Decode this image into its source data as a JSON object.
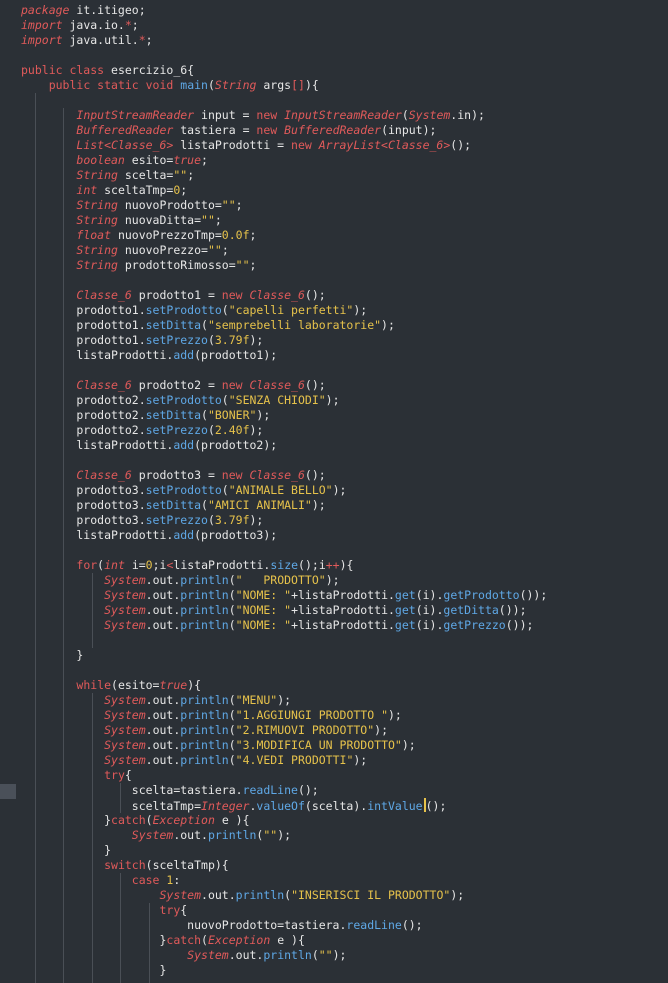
{
  "editor": {
    "language": "java",
    "cursor_line": 53,
    "lines": [
      [
        [
          "kwi",
          "package"
        ],
        [
          "in",
          " it.itigeo;"
        ]
      ],
      [
        [
          "kwi",
          "import"
        ],
        [
          "in",
          " java.io."
        ],
        [
          "kw",
          "*"
        ],
        [
          "in",
          ";"
        ]
      ],
      [
        [
          "kwi",
          "import"
        ],
        [
          "in",
          " java.util."
        ],
        [
          "kw",
          "*"
        ],
        [
          "in",
          ";"
        ]
      ],
      [],
      [
        [
          "kw",
          "public class "
        ],
        [
          "in",
          "esercizio_6{"
        ]
      ],
      [
        [
          "in",
          "    "
        ],
        [
          "kw",
          "public static void "
        ],
        [
          "fn",
          "main"
        ],
        [
          "in",
          "("
        ],
        [
          "ty",
          "String"
        ],
        [
          "in",
          " args"
        ],
        [
          "kw",
          "[]"
        ],
        [
          "in",
          "){"
        ]
      ],
      [],
      [
        [
          "in",
          "        "
        ],
        [
          "ty",
          "InputStreamReader"
        ],
        [
          "in",
          " input = "
        ],
        [
          "kw",
          "new "
        ],
        [
          "ty",
          "InputStreamReader"
        ],
        [
          "in",
          "("
        ],
        [
          "ty",
          "System"
        ],
        [
          "in",
          ".in);"
        ]
      ],
      [
        [
          "in",
          "        "
        ],
        [
          "ty",
          "BufferedReader"
        ],
        [
          "in",
          " tastiera = "
        ],
        [
          "kw",
          "new "
        ],
        [
          "ty",
          "BufferedReader"
        ],
        [
          "in",
          "(input);"
        ]
      ],
      [
        [
          "in",
          "        "
        ],
        [
          "ty",
          "List<Classe_6>"
        ],
        [
          "in",
          " listaProdotti = "
        ],
        [
          "kw",
          "new "
        ],
        [
          "ty",
          "ArrayList<Classe_6>"
        ],
        [
          "in",
          "();"
        ]
      ],
      [
        [
          "in",
          "        "
        ],
        [
          "ty",
          "boolean"
        ],
        [
          "in",
          " esito="
        ],
        [
          "ty",
          "true"
        ],
        [
          "in",
          ";"
        ]
      ],
      [
        [
          "in",
          "        "
        ],
        [
          "ty",
          "String"
        ],
        [
          "in",
          " scelta="
        ],
        [
          "st",
          "\"\""
        ],
        [
          "in",
          ";"
        ]
      ],
      [
        [
          "in",
          "        "
        ],
        [
          "ty",
          "int"
        ],
        [
          "in",
          " sceltaTmp="
        ],
        [
          "nm",
          "0"
        ],
        [
          "in",
          ";"
        ]
      ],
      [
        [
          "in",
          "        "
        ],
        [
          "ty",
          "String"
        ],
        [
          "in",
          " nuovoProdotto="
        ],
        [
          "st",
          "\"\""
        ],
        [
          "in",
          ";"
        ]
      ],
      [
        [
          "in",
          "        "
        ],
        [
          "ty",
          "String"
        ],
        [
          "in",
          " nuovaDitta="
        ],
        [
          "st",
          "\"\""
        ],
        [
          "in",
          ";"
        ]
      ],
      [
        [
          "in",
          "        "
        ],
        [
          "ty",
          "float"
        ],
        [
          "in",
          " nuovoPrezzoTmp="
        ],
        [
          "nm",
          "0.0f"
        ],
        [
          "in",
          ";"
        ]
      ],
      [
        [
          "in",
          "        "
        ],
        [
          "ty",
          "String"
        ],
        [
          "in",
          " nuovoPrezzo="
        ],
        [
          "st",
          "\"\""
        ],
        [
          "in",
          ";"
        ]
      ],
      [
        [
          "in",
          "        "
        ],
        [
          "ty",
          "String"
        ],
        [
          "in",
          " prodottoRimosso="
        ],
        [
          "st",
          "\"\""
        ],
        [
          "in",
          ";"
        ]
      ],
      [],
      [
        [
          "in",
          "        "
        ],
        [
          "ty",
          "Classe_6"
        ],
        [
          "in",
          " prodotto1 = "
        ],
        [
          "kw",
          "new "
        ],
        [
          "ty",
          "Classe_6"
        ],
        [
          "in",
          "();"
        ]
      ],
      [
        [
          "in",
          "        prodotto1."
        ],
        [
          "fn",
          "setProdotto"
        ],
        [
          "in",
          "("
        ],
        [
          "st",
          "\"capelli perfetti\""
        ],
        [
          "in",
          ");"
        ]
      ],
      [
        [
          "in",
          "        prodotto1."
        ],
        [
          "fn",
          "setDitta"
        ],
        [
          "in",
          "("
        ],
        [
          "st",
          "\"semprebelli laboratorie\""
        ],
        [
          "in",
          ");"
        ]
      ],
      [
        [
          "in",
          "        prodotto1."
        ],
        [
          "fn",
          "setPrezzo"
        ],
        [
          "in",
          "("
        ],
        [
          "nm",
          "3.79f"
        ],
        [
          "in",
          ");"
        ]
      ],
      [
        [
          "in",
          "        listaProdotti."
        ],
        [
          "fn",
          "add"
        ],
        [
          "in",
          "(prodotto1);"
        ]
      ],
      [],
      [
        [
          "in",
          "        "
        ],
        [
          "ty",
          "Classe_6"
        ],
        [
          "in",
          " prodotto2 = "
        ],
        [
          "kw",
          "new "
        ],
        [
          "ty",
          "Classe_6"
        ],
        [
          "in",
          "();"
        ]
      ],
      [
        [
          "in",
          "        prodotto2."
        ],
        [
          "fn",
          "setProdotto"
        ],
        [
          "in",
          "("
        ],
        [
          "st",
          "\"SENZA CHIODI\""
        ],
        [
          "in",
          ");"
        ]
      ],
      [
        [
          "in",
          "        prodotto2."
        ],
        [
          "fn",
          "setDitta"
        ],
        [
          "in",
          "("
        ],
        [
          "st",
          "\"BONER\""
        ],
        [
          "in",
          ");"
        ]
      ],
      [
        [
          "in",
          "        prodotto2."
        ],
        [
          "fn",
          "setPrezzo"
        ],
        [
          "in",
          "("
        ],
        [
          "nm",
          "2.40f"
        ],
        [
          "in",
          ");"
        ]
      ],
      [
        [
          "in",
          "        listaProdotti."
        ],
        [
          "fn",
          "add"
        ],
        [
          "in",
          "(prodotto2);"
        ]
      ],
      [],
      [
        [
          "in",
          "        "
        ],
        [
          "ty",
          "Classe_6"
        ],
        [
          "in",
          " prodotto3 = "
        ],
        [
          "kw",
          "new "
        ],
        [
          "ty",
          "Classe_6"
        ],
        [
          "in",
          "();"
        ]
      ],
      [
        [
          "in",
          "        prodotto3."
        ],
        [
          "fn",
          "setProdotto"
        ],
        [
          "in",
          "("
        ],
        [
          "st",
          "\"ANIMALE BELLO\""
        ],
        [
          "in",
          ");"
        ]
      ],
      [
        [
          "in",
          "        prodotto3."
        ],
        [
          "fn",
          "setDitta"
        ],
        [
          "in",
          "("
        ],
        [
          "st",
          "\"AMICI ANIMALI\""
        ],
        [
          "in",
          ");"
        ]
      ],
      [
        [
          "in",
          "        prodotto3."
        ],
        [
          "fn",
          "setPrezzo"
        ],
        [
          "in",
          "("
        ],
        [
          "nm",
          "3.79f"
        ],
        [
          "in",
          ");"
        ]
      ],
      [
        [
          "in",
          "        listaProdotti."
        ],
        [
          "fn",
          "add"
        ],
        [
          "in",
          "(prodotto3);"
        ]
      ],
      [],
      [
        [
          "in",
          "        "
        ],
        [
          "kw",
          "for"
        ],
        [
          "in",
          "("
        ],
        [
          "ty",
          "int"
        ],
        [
          "in",
          " i="
        ],
        [
          "nm",
          "0"
        ],
        [
          "in",
          ";i"
        ],
        [
          "kw",
          "<"
        ],
        [
          "in",
          "listaProdotti."
        ],
        [
          "fn",
          "size"
        ],
        [
          "in",
          "();i"
        ],
        [
          "kw",
          "++"
        ],
        [
          "in",
          "){"
        ]
      ],
      [
        [
          "in",
          "            "
        ],
        [
          "ty",
          "System"
        ],
        [
          "in",
          ".out."
        ],
        [
          "fn",
          "println"
        ],
        [
          "in",
          "("
        ],
        [
          "st",
          "\"   PRODOTTO\""
        ],
        [
          "in",
          ");"
        ]
      ],
      [
        [
          "in",
          "            "
        ],
        [
          "ty",
          "System"
        ],
        [
          "in",
          ".out."
        ],
        [
          "fn",
          "println"
        ],
        [
          "in",
          "("
        ],
        [
          "st",
          "\"NOME: \""
        ],
        [
          "in",
          "+listaProdotti."
        ],
        [
          "fn",
          "get"
        ],
        [
          "in",
          "(i)."
        ],
        [
          "fn",
          "getProdotto"
        ],
        [
          "in",
          "());"
        ]
      ],
      [
        [
          "in",
          "            "
        ],
        [
          "ty",
          "System"
        ],
        [
          "in",
          ".out."
        ],
        [
          "fn",
          "println"
        ],
        [
          "in",
          "("
        ],
        [
          "st",
          "\"NOME: \""
        ],
        [
          "in",
          "+listaProdotti."
        ],
        [
          "fn",
          "get"
        ],
        [
          "in",
          "(i)."
        ],
        [
          "fn",
          "getDitta"
        ],
        [
          "in",
          "());"
        ]
      ],
      [
        [
          "in",
          "            "
        ],
        [
          "ty",
          "System"
        ],
        [
          "in",
          ".out."
        ],
        [
          "fn",
          "println"
        ],
        [
          "in",
          "("
        ],
        [
          "st",
          "\"NOME: \""
        ],
        [
          "in",
          "+listaProdotti."
        ],
        [
          "fn",
          "get"
        ],
        [
          "in",
          "(i)."
        ],
        [
          "fn",
          "getPrezzo"
        ],
        [
          "in",
          "());"
        ]
      ],
      [],
      [
        [
          "in",
          "        }"
        ]
      ],
      [],
      [
        [
          "in",
          "        "
        ],
        [
          "kw",
          "while"
        ],
        [
          "in",
          "(esito="
        ],
        [
          "ty",
          "true"
        ],
        [
          "in",
          "){"
        ]
      ],
      [
        [
          "in",
          "            "
        ],
        [
          "ty",
          "System"
        ],
        [
          "in",
          ".out."
        ],
        [
          "fn",
          "println"
        ],
        [
          "in",
          "("
        ],
        [
          "st",
          "\"MENU\""
        ],
        [
          "in",
          ");"
        ]
      ],
      [
        [
          "in",
          "            "
        ],
        [
          "ty",
          "System"
        ],
        [
          "in",
          ".out."
        ],
        [
          "fn",
          "println"
        ],
        [
          "in",
          "("
        ],
        [
          "st",
          "\"1.AGGIUNGI PRODOTTO \""
        ],
        [
          "in",
          ");"
        ]
      ],
      [
        [
          "in",
          "            "
        ],
        [
          "ty",
          "System"
        ],
        [
          "in",
          ".out."
        ],
        [
          "fn",
          "println"
        ],
        [
          "in",
          "("
        ],
        [
          "st",
          "\"2.RIMUOVI PRODOTTO\""
        ],
        [
          "in",
          ");"
        ]
      ],
      [
        [
          "in",
          "            "
        ],
        [
          "ty",
          "System"
        ],
        [
          "in",
          ".out."
        ],
        [
          "fn",
          "println"
        ],
        [
          "in",
          "("
        ],
        [
          "st",
          "\"3.MODIFICA UN PRODOTTO\""
        ],
        [
          "in",
          ");"
        ]
      ],
      [
        [
          "in",
          "            "
        ],
        [
          "ty",
          "System"
        ],
        [
          "in",
          ".out."
        ],
        [
          "fn",
          "println"
        ],
        [
          "in",
          "("
        ],
        [
          "st",
          "\"4.VEDI PRODOTTI\""
        ],
        [
          "in",
          ");"
        ]
      ],
      [
        [
          "in",
          "            "
        ],
        [
          "kw",
          "try"
        ],
        [
          "in",
          "{"
        ]
      ],
      [
        [
          "in",
          "                scelta=tastiera."
        ],
        [
          "fn",
          "readLine"
        ],
        [
          "in",
          "();"
        ]
      ],
      [
        [
          "in",
          "                sceltaTmp="
        ],
        [
          "ty",
          "Integer"
        ],
        [
          "in",
          "."
        ],
        [
          "fn",
          "valueOf"
        ],
        [
          "in",
          "(scelta)."
        ],
        [
          "fn",
          "intValue"
        ],
        [
          "in",
          "();"
        ]
      ],
      [
        [
          "in",
          "            }"
        ],
        [
          "kw",
          "catch"
        ],
        [
          "in",
          "("
        ],
        [
          "ty",
          "Exception"
        ],
        [
          "in",
          " e ){"
        ]
      ],
      [
        [
          "in",
          "                "
        ],
        [
          "ty",
          "System"
        ],
        [
          "in",
          ".out."
        ],
        [
          "fn",
          "println"
        ],
        [
          "in",
          "("
        ],
        [
          "st",
          "\"\""
        ],
        [
          "in",
          ");"
        ]
      ],
      [
        [
          "in",
          "            }"
        ]
      ],
      [
        [
          "in",
          "            "
        ],
        [
          "kw",
          "switch"
        ],
        [
          "in",
          "(sceltaTmp){"
        ]
      ],
      [
        [
          "in",
          "                "
        ],
        [
          "kw",
          "case "
        ],
        [
          "nm",
          "1"
        ],
        [
          "in",
          ":"
        ]
      ],
      [
        [
          "in",
          "                    "
        ],
        [
          "ty",
          "System"
        ],
        [
          "in",
          ".out."
        ],
        [
          "fn",
          "println"
        ],
        [
          "in",
          "("
        ],
        [
          "st",
          "\"INSERISCI IL PRODOTTO\""
        ],
        [
          "in",
          ");"
        ]
      ],
      [
        [
          "in",
          "                    "
        ],
        [
          "kw",
          "try"
        ],
        [
          "in",
          "{"
        ]
      ],
      [
        [
          "in",
          "                        nuovoProdotto=tastiera."
        ],
        [
          "fn",
          "readLine"
        ],
        [
          "in",
          "();"
        ]
      ],
      [
        [
          "in",
          "                    }"
        ],
        [
          "kw",
          "catch"
        ],
        [
          "in",
          "("
        ],
        [
          "ty",
          "Exception"
        ],
        [
          "in",
          " e ){"
        ]
      ],
      [
        [
          "in",
          "                        "
        ],
        [
          "ty",
          "System"
        ],
        [
          "in",
          ".out."
        ],
        [
          "fn",
          "println"
        ],
        [
          "in",
          "("
        ],
        [
          "st",
          "\"\""
        ],
        [
          "in",
          ");"
        ]
      ],
      [
        [
          "in",
          "                    }"
        ]
      ]
    ]
  }
}
